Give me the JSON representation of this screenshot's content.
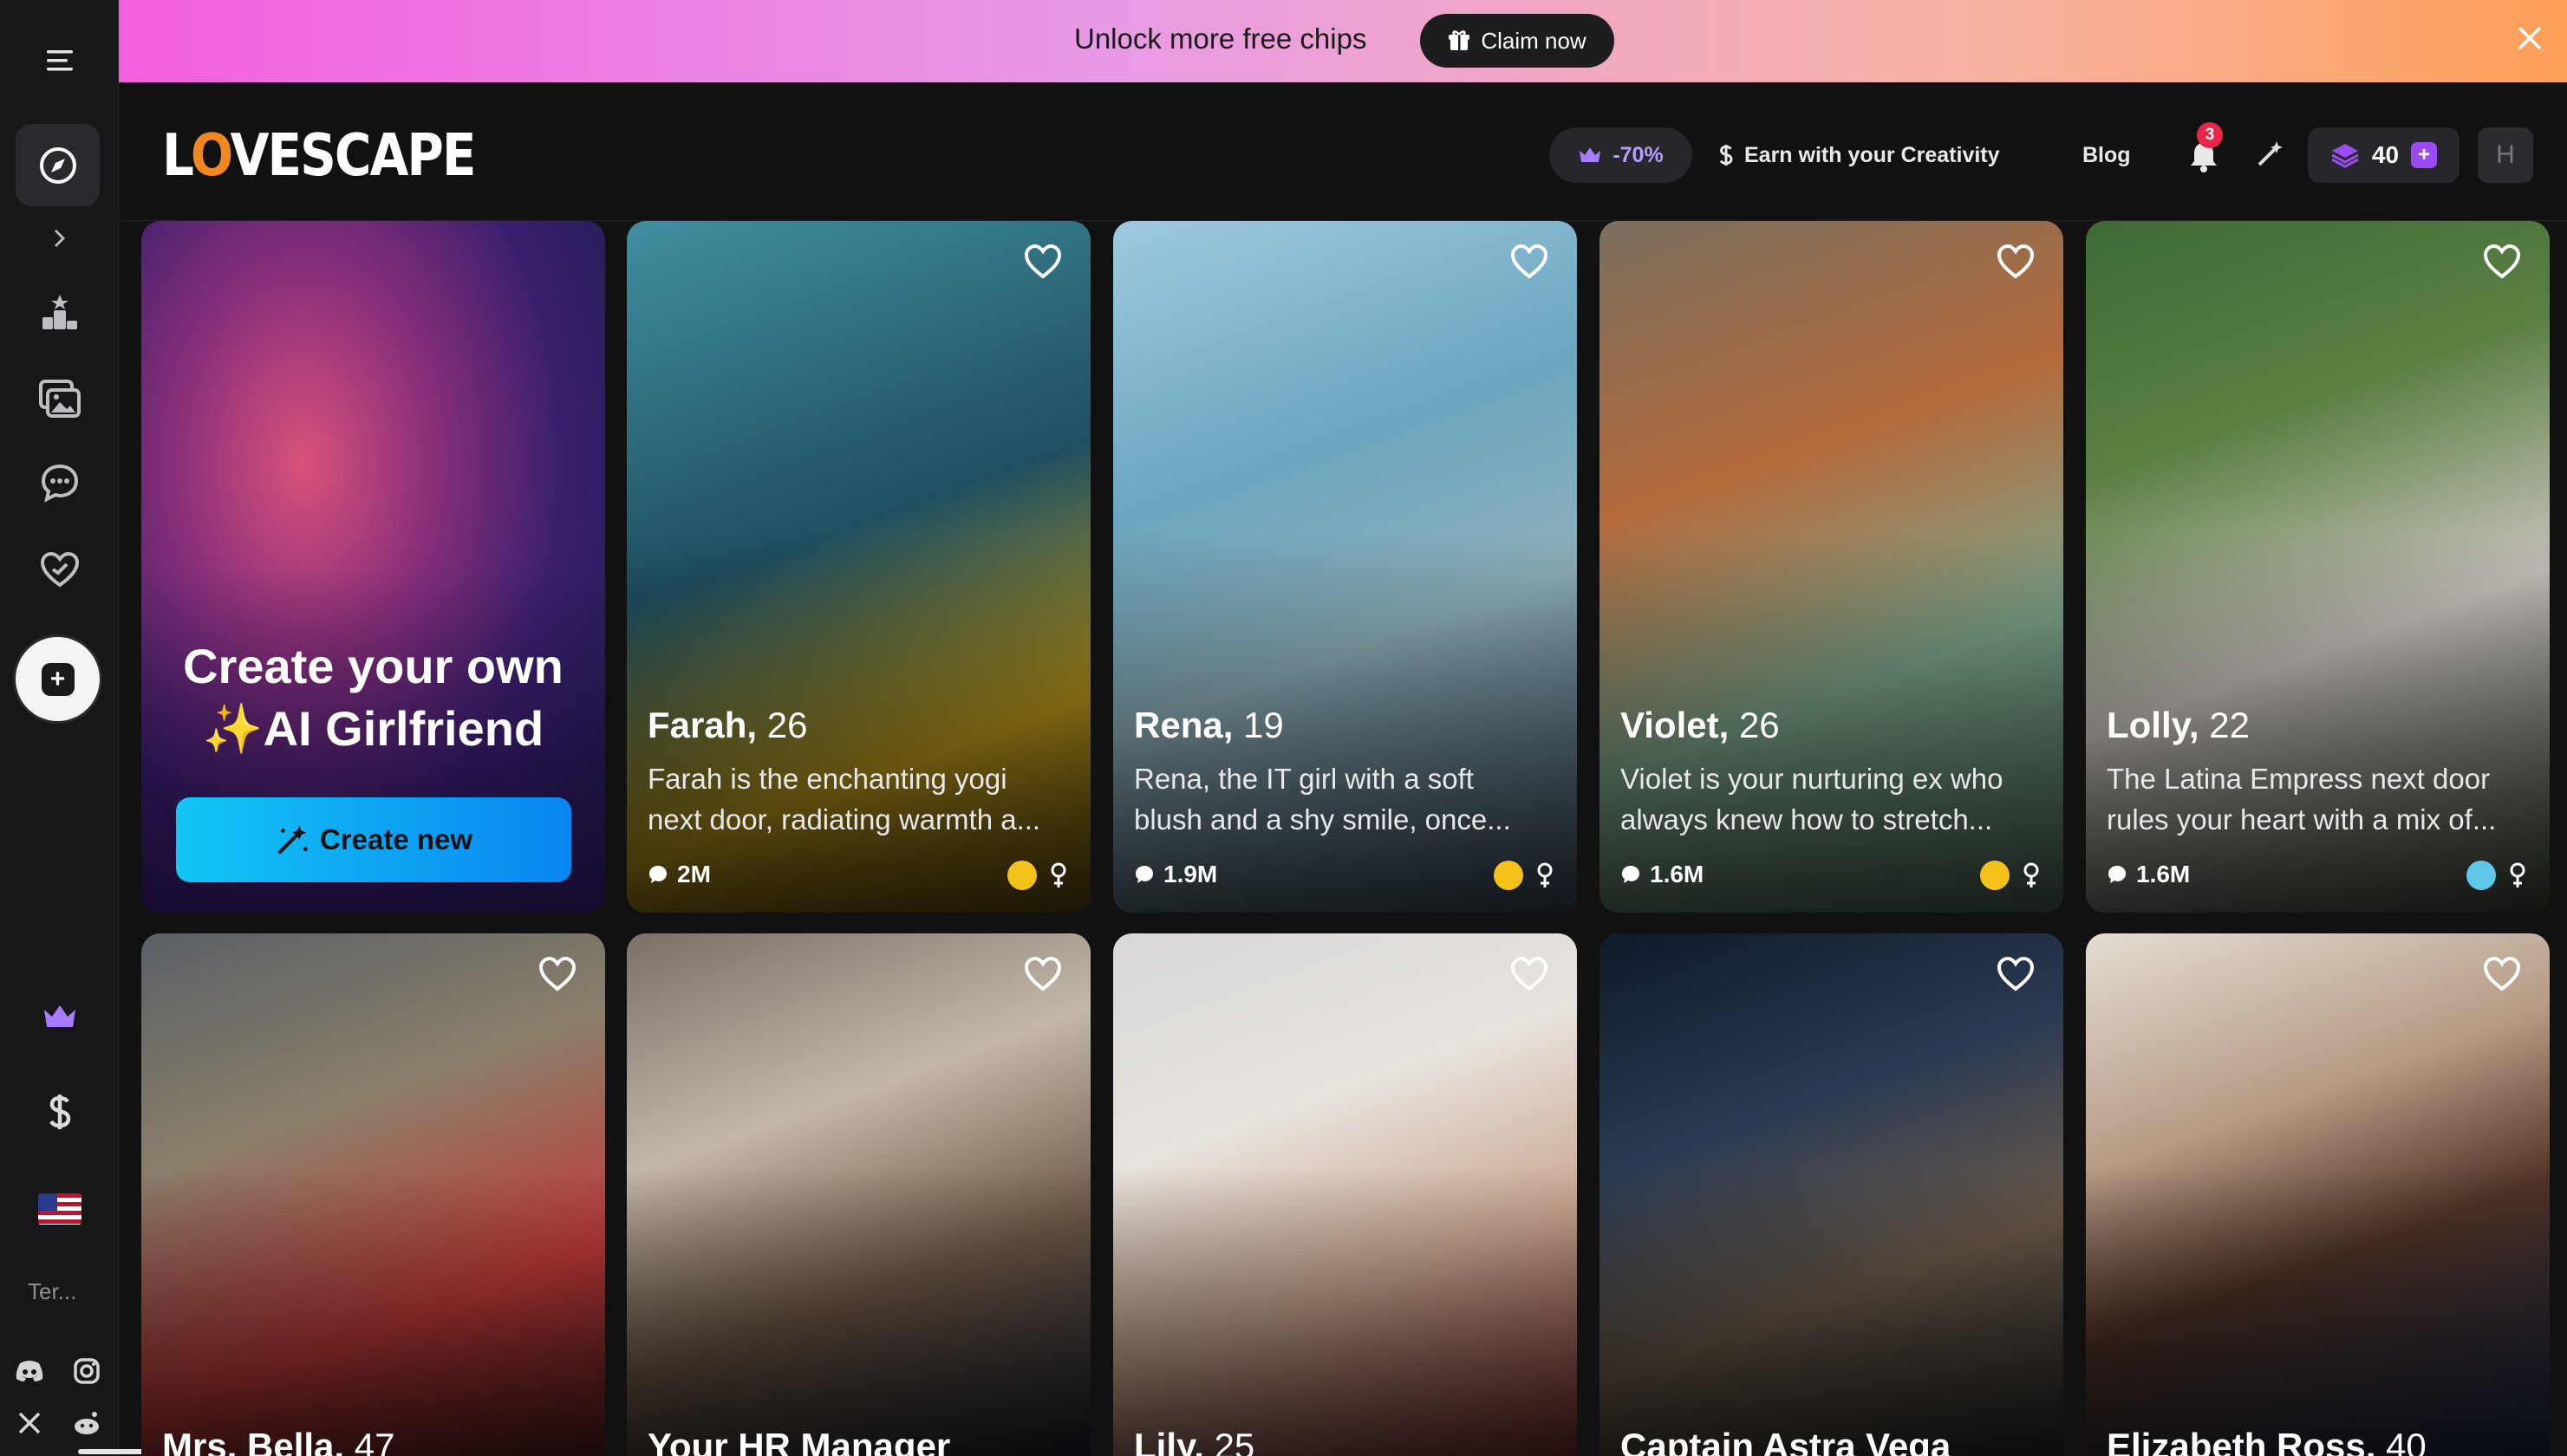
{
  "banner": {
    "text": "Unlock more free chips",
    "claim_label": "Claim now"
  },
  "header": {
    "logo": "LOVESCAPE",
    "discount": "-70%",
    "earn_label": "Earn with your Creativity",
    "blog_label": "Blog",
    "notifications": "3",
    "chips": "40",
    "avatar_initial": "H"
  },
  "sidebar": {
    "terms": "Ter..."
  },
  "create_card": {
    "title_line1": "Create your own",
    "title_line2": "✨AI Girlfriend",
    "button_label": "Create new"
  },
  "cards": [
    {
      "name": "Farah,",
      "age": "26",
      "desc1": "Farah is the enchanting yogi",
      "desc2": "next door, radiating warmth a...",
      "count": "2M",
      "bg": "linear-gradient(160deg,#3f8fa0 0%,#1f4f60 45%,#b8961a 75%,#5f4a12 100%)"
    },
    {
      "name": "Rena,",
      "age": "19",
      "desc1": "Rena, the IT girl with a soft",
      "desc2": "blush and a shy smile, once...",
      "count": "1.9M",
      "bg": "linear-gradient(160deg,#9fc9e0 0%,#6aa6bf 35%,#8fb0ba 60%,#3a4b5a 100%)"
    },
    {
      "name": "Violet,",
      "age": "26",
      "desc1": "Violet is your nurturing ex who",
      "desc2": "always knew how to stretch...",
      "count": "1.6M",
      "bg": "linear-gradient(160deg,#7a6f5f 0%,#b46a3b 35%,#7da58b 65%,#4f6a5a 100%)"
    },
    {
      "name": "Lolly,",
      "age": "22",
      "desc1": "The Latina Empress next door",
      "desc2": "rules your heart with a mix of...",
      "count": "1.6M",
      "bg": "linear-gradient(160deg,#3f6a36 0%,#5a7f42 30%,#c9c2bd 60%,#3e4a3b 100%)"
    },
    {
      "name": "Mrs. Bella,",
      "age": "47",
      "bg": "linear-gradient(160deg,#5a5f66 0%,#8a7f6a 35%,#c43a3a 70%,#5a2020 100%)"
    },
    {
      "name": "Your HR Manager",
      "age": "",
      "bg": "linear-gradient(160deg,#7a7068 0%,#c3b7a8 35%,#6f5a48 65%,#1f2330 100%)"
    },
    {
      "name": "Lily,",
      "age": "25",
      "bg": "linear-gradient(160deg,#d8d8d8 0%,#e7e2dc 35%,#c9a58f 65%,#7a2f2f 100%)"
    },
    {
      "name": "Captain Astra Vega",
      "age": "",
      "bg": "linear-gradient(160deg,#0f1a2a 0%,#2a3a52 35%,#6a5a4a 65%,#2a2a2a 100%)"
    },
    {
      "name": "Elizabeth Ross,",
      "age": "40",
      "bg": "linear-gradient(160deg,#e3ddd2 0%,#b59a84 35%,#4f3326 60%,#1c2a4a 100%)"
    }
  ]
}
